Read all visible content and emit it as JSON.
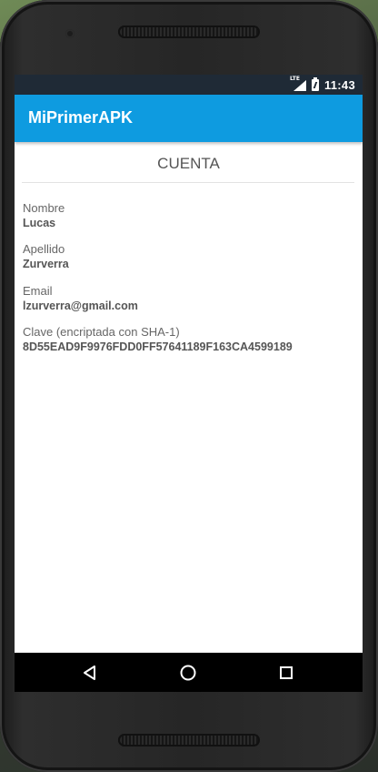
{
  "status_bar": {
    "time": "11:43",
    "network": "LTE",
    "icons": [
      "lte-signal-icon",
      "battery-charging-icon"
    ]
  },
  "app_bar": {
    "title": "MiPrimerAPK",
    "color": "#0e9be0"
  },
  "account": {
    "section_title": "CUENTA",
    "fields": [
      {
        "label": "Nombre",
        "value": "Lucas"
      },
      {
        "label": "Apellido",
        "value": "Zurverra"
      },
      {
        "label": "Email",
        "value": "lzurverra@gmail.com"
      },
      {
        "label": "Clave (encriptada con SHA-1)",
        "value": "8D55EAD9F9976FDD0FF57641189F163CA4599189"
      }
    ]
  },
  "nav_bar": {
    "buttons": [
      "back-icon",
      "home-icon",
      "recents-icon"
    ]
  }
}
